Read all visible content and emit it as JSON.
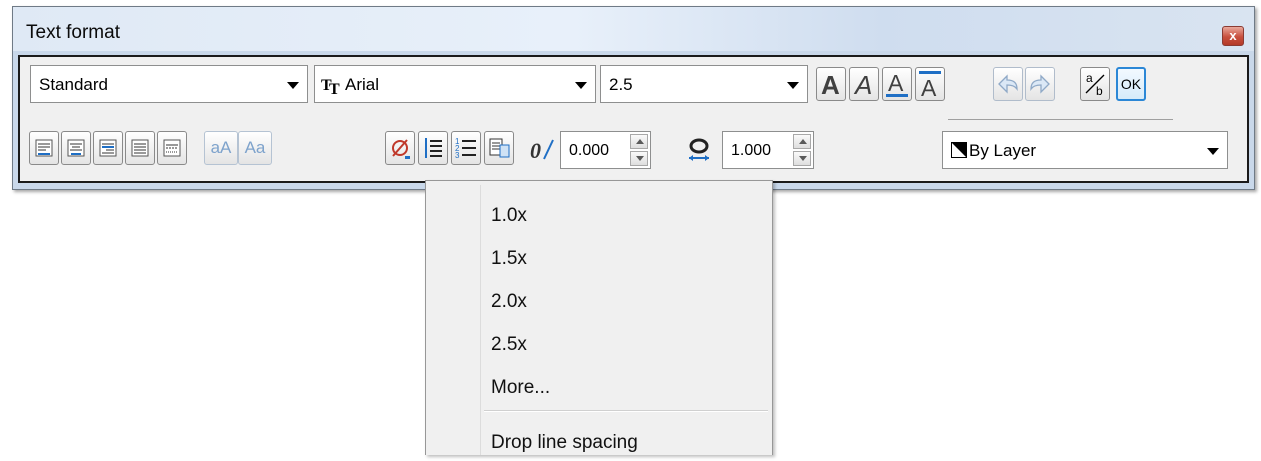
{
  "window": {
    "title": "Text format",
    "close_label": "x"
  },
  "row1": {
    "style_combo": {
      "value": "Standard"
    },
    "font_combo": {
      "value": "Arial",
      "icon": "truetype-font-icon"
    },
    "height_combo": {
      "value": "2.5"
    },
    "buttons": [
      "bold",
      "italic",
      "underline",
      "overline",
      "undo",
      "redo",
      "stack-fraction",
      "ok"
    ],
    "fraction_top": "a",
    "fraction_bottom": "b",
    "ok_label": "OK"
  },
  "row2": {
    "align_buttons": [
      "align-left",
      "align-center",
      "align-right",
      "justify",
      "distribute"
    ],
    "case_upper_label": "aA",
    "case_lower_label": "Aa",
    "oblique_value": "0.000",
    "width_factor_value": "1.000",
    "color_combo": {
      "value": "By Layer"
    }
  },
  "line_spacing_menu": {
    "items": [
      "1.0x",
      "1.5x",
      "2.0x",
      "2.5x",
      "More..."
    ],
    "footer_item": "Drop line spacing"
  },
  "colors": {
    "accent": "#1f6fc5",
    "window_bg": "#c9d8ea",
    "panel_bg": "#f0f0f0",
    "close_red": "#c8503e"
  }
}
